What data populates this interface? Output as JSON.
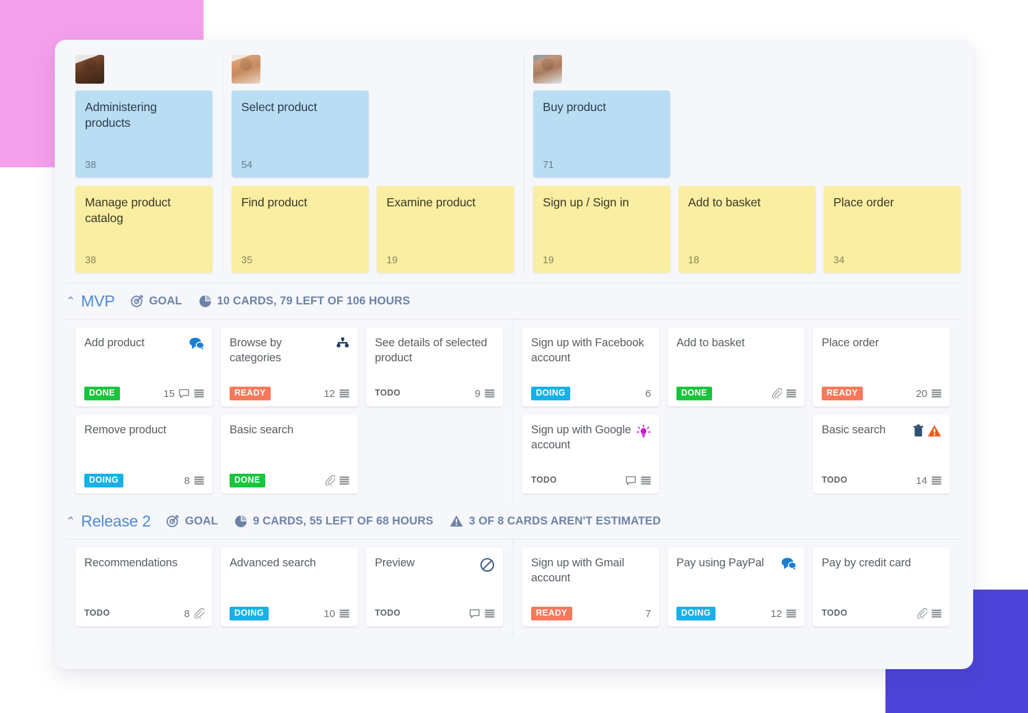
{
  "decor": {
    "pink": "#f49fec",
    "blue": "#4c44d8"
  },
  "story_map": {
    "groups": [
      {
        "persona": "persona-1",
        "activities": [
          {
            "title": "Administering products",
            "estimate": "38",
            "color": "blue"
          }
        ],
        "steps": [
          {
            "title": "Manage product catalog",
            "estimate": "38",
            "color": "yellow"
          }
        ]
      },
      {
        "persona": "persona-2",
        "activities": [
          {
            "title": "Select product",
            "estimate": "54",
            "color": "blue"
          }
        ],
        "steps": [
          {
            "title": "Find product",
            "estimate": "35",
            "color": "yellow"
          },
          {
            "title": "Examine product",
            "estimate": "19",
            "color": "yellow"
          }
        ]
      },
      {
        "persona": "persona-3",
        "activities": [
          {
            "title": "Buy product",
            "estimate": "71",
            "color": "blue"
          }
        ],
        "steps": [
          {
            "title": "Sign up / Sign in",
            "estimate": "19",
            "color": "yellow"
          },
          {
            "title": "Add to basket",
            "estimate": "18",
            "color": "yellow"
          },
          {
            "title": "Place order",
            "estimate": "34",
            "color": "yellow"
          }
        ]
      }
    ]
  },
  "releases": [
    {
      "name": "MVP",
      "goal_label": "GOAL",
      "stats_label": "10 CARDS, 79 LEFT OF 106 HOURS",
      "warning_label": "",
      "groups": [
        {
          "columns": [
            [
              {
                "title": "Add product",
                "status": "DONE",
                "status_key": "done",
                "estimate": "15",
                "top_icons": [
                  "comments-filled-icon"
                ],
                "bottom_icons": [
                  "comment-icon",
                  "description-icon"
                ]
              },
              {
                "title": "Remove product",
                "status": "DOING",
                "status_key": "doing",
                "estimate": "8",
                "top_icons": [],
                "bottom_icons": [
                  "description-icon"
                ]
              }
            ],
            [
              {
                "title": "Browse by categories",
                "status": "READY",
                "status_key": "ready",
                "estimate": "12",
                "top_icons": [
                  "sitemap-icon"
                ],
                "bottom_icons": [
                  "description-icon"
                ]
              },
              {
                "title": "Basic search",
                "status": "DONE",
                "status_key": "done",
                "estimate": "",
                "top_icons": [],
                "bottom_icons": [
                  "attachment-icon",
                  "description-icon"
                ]
              }
            ],
            [
              {
                "title": "See details of selected product",
                "status": "TODO",
                "status_key": "todo",
                "estimate": "9",
                "top_icons": [],
                "bottom_icons": [
                  "description-icon"
                ]
              }
            ]
          ]
        },
        {
          "columns": [
            [
              {
                "title": "Sign up with Facebook account",
                "status": "DOING",
                "status_key": "doing",
                "estimate": "6",
                "top_icons": [],
                "bottom_icons": []
              },
              {
                "title": "Sign up with Google account",
                "status": "TODO",
                "status_key": "todo",
                "estimate": "",
                "top_icons": [
                  "lightbulb-icon"
                ],
                "bottom_icons": [
                  "comment-icon",
                  "description-icon"
                ]
              }
            ],
            [
              {
                "title": "Add to basket",
                "status": "DONE",
                "status_key": "done",
                "estimate": "",
                "top_icons": [],
                "bottom_icons": [
                  "attachment-icon",
                  "description-icon"
                ]
              }
            ],
            [
              {
                "title": "Place order",
                "status": "READY",
                "status_key": "ready",
                "estimate": "20",
                "top_icons": [],
                "bottom_icons": [
                  "description-icon"
                ]
              },
              {
                "title": "Basic search",
                "status": "TODO",
                "status_key": "todo",
                "estimate": "14",
                "top_icons": [
                  "trash-icon",
                  "warning-icon"
                ],
                "bottom_icons": [
                  "description-icon"
                ]
              }
            ]
          ]
        }
      ]
    },
    {
      "name": "Release 2",
      "goal_label": "GOAL",
      "stats_label": "9 CARDS, 55 LEFT OF 68 HOURS",
      "warning_label": "3 OF 8 CARDS AREN'T ESTIMATED",
      "groups": [
        {
          "columns": [
            [
              {
                "title": "Recommendations",
                "status": "TODO",
                "status_key": "todo",
                "estimate": "8",
                "top_icons": [],
                "bottom_icons": [
                  "attachment-icon"
                ]
              }
            ],
            [
              {
                "title": "Advanced search",
                "status": "DOING",
                "status_key": "doing",
                "estimate": "10",
                "top_icons": [],
                "bottom_icons": [
                  "description-icon"
                ]
              }
            ],
            [
              {
                "title": "Preview",
                "status": "TODO",
                "status_key": "todo",
                "estimate": "",
                "top_icons": [
                  "blocked-icon"
                ],
                "bottom_icons": [
                  "comment-icon",
                  "description-icon"
                ]
              }
            ]
          ]
        },
        {
          "columns": [
            [
              {
                "title": "Sign up with Gmail account",
                "status": "READY",
                "status_key": "ready",
                "estimate": "7",
                "top_icons": [],
                "bottom_icons": []
              }
            ],
            [
              {
                "title": "Pay using PayPal",
                "status": "DOING",
                "status_key": "doing",
                "estimate": "12",
                "top_icons": [
                  "comments-filled-icon"
                ],
                "bottom_icons": [
                  "description-icon"
                ]
              }
            ],
            [
              {
                "title": "Pay by credit card",
                "status": "TODO",
                "status_key": "todo",
                "estimate": "",
                "top_icons": [],
                "bottom_icons": [
                  "attachment-icon",
                  "description-icon"
                ]
              }
            ]
          ]
        }
      ]
    }
  ],
  "colors": {
    "done": "#18c53c",
    "ready": "#f9785c",
    "doing": "#17b0e8",
    "sticky_blue": "#b9ddf2",
    "sticky_yellow": "#faeea2",
    "release_name": "#4d8ad0",
    "meta_text": "#6d83a6"
  }
}
